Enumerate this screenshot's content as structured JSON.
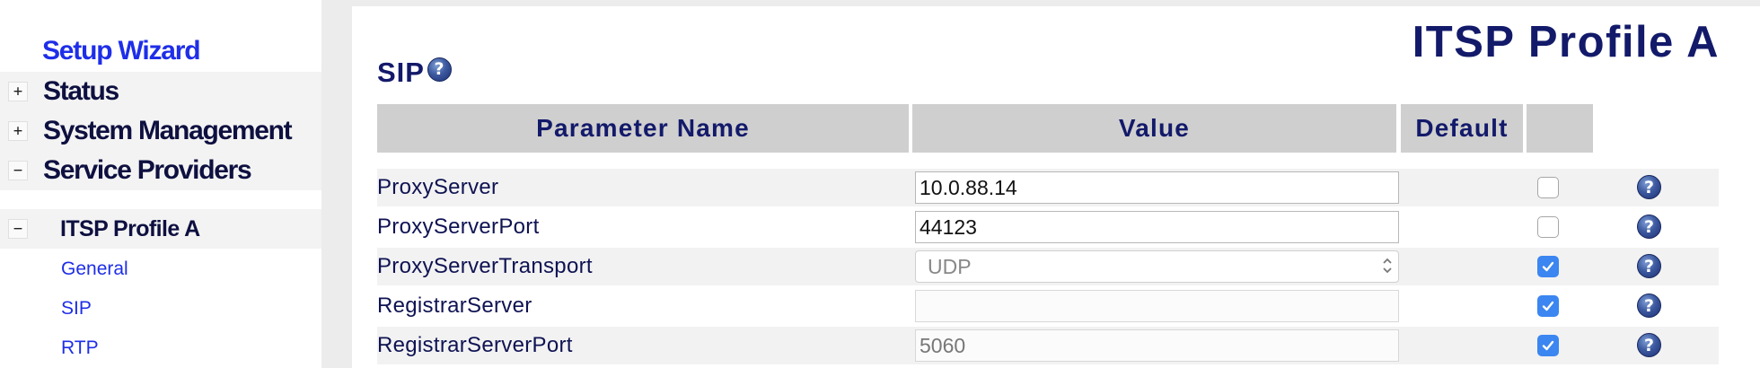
{
  "sidebar": {
    "setup_wizard": "Setup Wizard",
    "items": [
      {
        "toggle": "+",
        "label": "Status"
      },
      {
        "toggle": "+",
        "label": "System Management"
      },
      {
        "toggle": "−",
        "label": "Service Providers"
      }
    ],
    "sub_item": {
      "toggle": "−",
      "label": "ITSP Profile A"
    },
    "links": [
      "General",
      "SIP",
      "RTP"
    ]
  },
  "main": {
    "page_title": "ITSP Profile A",
    "section_title": "SIP",
    "help_glyph": "?",
    "table": {
      "headers": [
        "Parameter Name",
        "Value",
        "Default"
      ],
      "rows": [
        {
          "name": "ProxyServer",
          "value": "10.0.88.14",
          "default": false,
          "type": "text"
        },
        {
          "name": "ProxyServerPort",
          "value": "44123",
          "default": false,
          "type": "text"
        },
        {
          "name": "ProxyServerTransport",
          "value": "UDP",
          "default": true,
          "type": "select"
        },
        {
          "name": "RegistrarServer",
          "value": "",
          "default": true,
          "type": "text"
        },
        {
          "name": "RegistrarServerPort",
          "value": "5060",
          "default": true,
          "type": "text"
        }
      ]
    }
  },
  "colors": {
    "link": "#1e2ee8",
    "heading": "#131a6a",
    "checkbox_checked": "#3b86f0",
    "header_bg": "#cfcfcf"
  },
  "icons": [
    "help-icon",
    "plus-icon",
    "minus-icon",
    "checkmark-icon",
    "select-chevron-icon"
  ]
}
